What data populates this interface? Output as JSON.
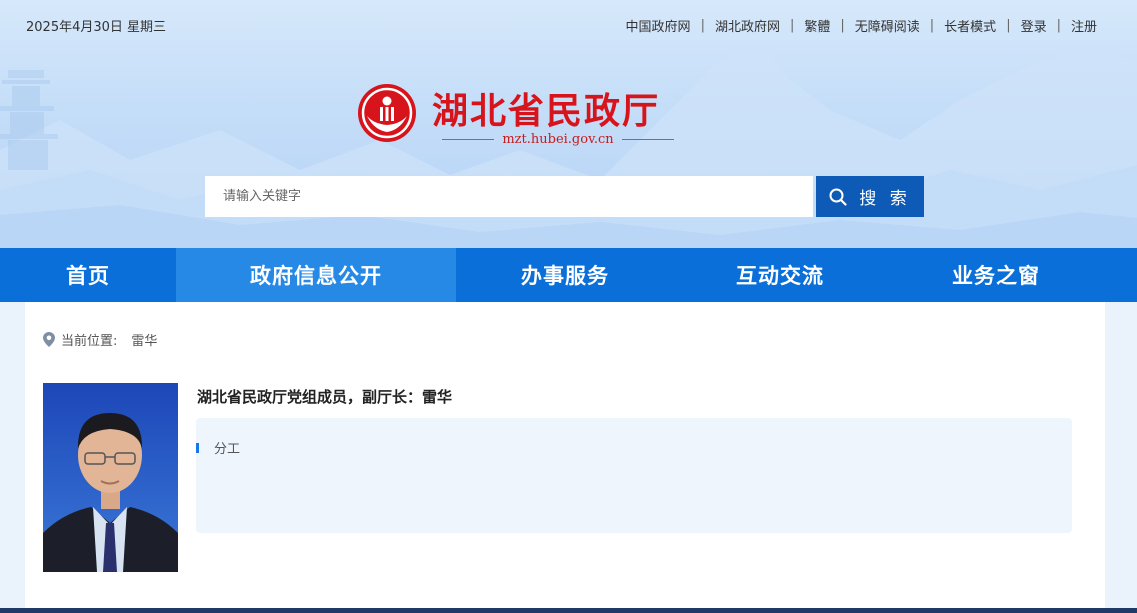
{
  "header": {
    "date": "2025年4月30日  星期三",
    "links": [
      "中国政府网",
      "湖北政府网",
      "繁體",
      "无障碍阅读",
      "长者模式",
      "登录",
      "注册"
    ],
    "site_title": "湖北省民政厅",
    "site_url": "mzt.hubei.gov.cn",
    "brand_color": "#d7141b"
  },
  "search": {
    "placeholder": "请输入关键字",
    "button_label": "搜 索",
    "button_icon": "search-icon"
  },
  "nav": {
    "items": [
      "首页",
      "政府信息公开",
      "办事服务",
      "互动交流",
      "业务之窗"
    ],
    "active_index": 1,
    "color": "#0a6fd8"
  },
  "breadcrumb": {
    "icon": "location-pin-icon",
    "label": "当前位置:",
    "current": "雷华"
  },
  "profile": {
    "title": "湖北省民政厅党组成员，副厅长：雷华",
    "duty_label": "分工"
  }
}
